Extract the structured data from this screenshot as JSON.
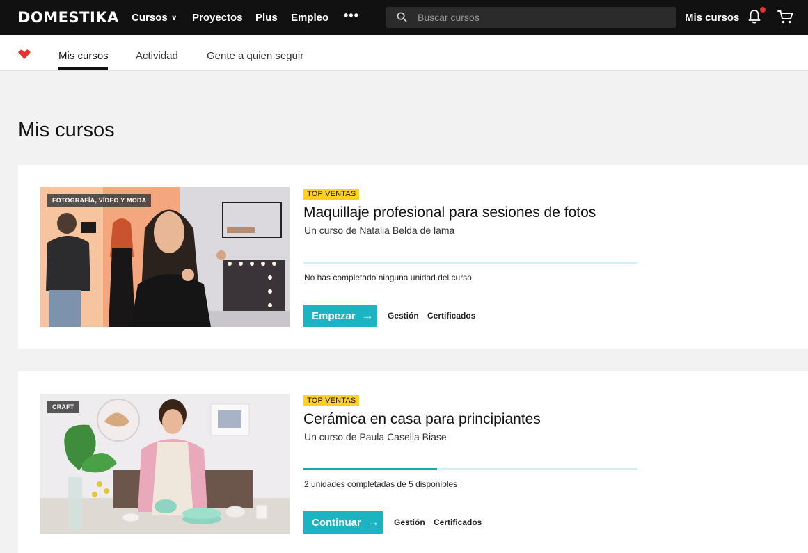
{
  "header": {
    "logo": "DOMESTIKA",
    "nav": [
      "Cursos",
      "Proyectos",
      "Plus",
      "Empleo"
    ],
    "more_label": "•••",
    "search_placeholder": "Buscar cursos",
    "my_courses": "Mis cursos",
    "icons": [
      "search-icon",
      "bell-icon",
      "cart-icon"
    ],
    "notification_color": "#e8322b"
  },
  "subnav": {
    "tabs": [
      "Mis cursos",
      "Actividad",
      "Gente a quien seguir"
    ],
    "active_tab": "Mis cursos",
    "brand_color": "#e8322b"
  },
  "page": {
    "title": "Mis cursos"
  },
  "courses": [
    {
      "category": "FOTOGRAFÍA, VÍDEO Y MODA",
      "badge": "TOP VENTAS",
      "title": "Maquillaje profesional para sesiones de fotos",
      "author": "Un curso de Natalia Belda de lama",
      "progress": 0,
      "progress_text": "No has completado ninguna unidad del curso",
      "cta": "Empezar",
      "link_1": "Gestión",
      "link_2": "Certificados"
    },
    {
      "category": "CRAFT",
      "badge": "TOP VENTAS",
      "title": "Cerámica en casa para principiantes",
      "author": "Un curso de Paula Casella Biase",
      "progress": 0.4,
      "progress_text": "2 unidades completadas de 5 disponibles",
      "cta": "Continuar",
      "link_1": "Gestión",
      "link_2": "Certificados"
    }
  ],
  "colors": {
    "accent": "#1bb4c0",
    "badge": "#ffd21f",
    "progress_track": "#d2f0f2"
  }
}
